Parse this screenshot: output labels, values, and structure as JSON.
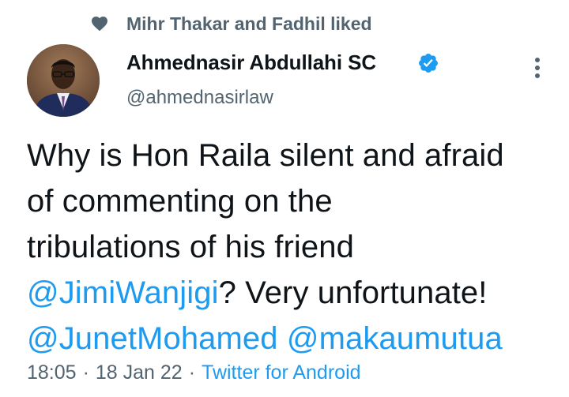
{
  "social_context": {
    "icon": "heart-icon",
    "text": "Mihr Thakar and Fadhil liked"
  },
  "author": {
    "name": "Ahmednasir Abdullahi SC",
    "handle": "@ahmednasirlaw",
    "verified": true,
    "avatar": "avatar"
  },
  "tweet": {
    "line1": "Why is Hon Raila silent and afraid",
    "line2": "of commenting on the",
    "line3": "tribulations of his friend",
    "mention1": "@JimiWanjigi",
    "line4_rest": "? Very unfortunate!",
    "mention2": "@JunetMohamed",
    "mention3": "@makaumutua"
  },
  "meta": {
    "time": "18:05",
    "date": "18 Jan 22",
    "separator": "·",
    "source": "Twitter for Android"
  },
  "colors": {
    "text_primary": "#0f1419",
    "text_secondary": "#536471",
    "accent": "#1d9bf0",
    "background": "#ffffff"
  }
}
